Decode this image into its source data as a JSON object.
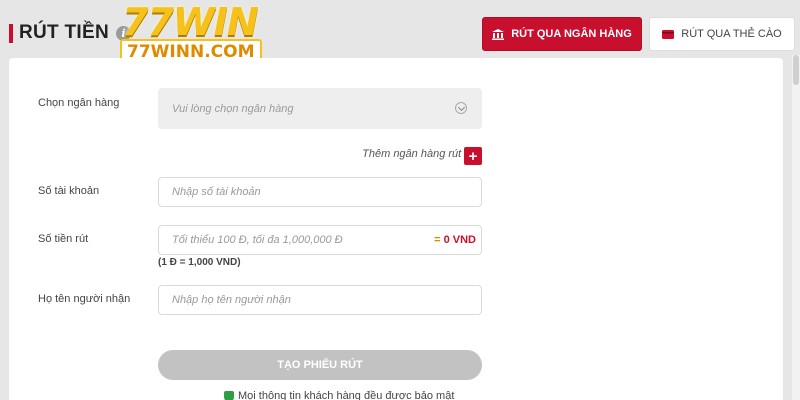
{
  "header": {
    "title": "RÚT TIỀN",
    "info_icon": "i",
    "logo_main": "77WIN",
    "logo_domain": "77WINN.COM"
  },
  "tabs": [
    {
      "label": "RÚT QUA NGÂN HÀNG",
      "icon": "bank-icon",
      "active": true
    },
    {
      "label": "RÚT QUA THẺ CÀO",
      "icon": "card-icon",
      "active": false
    }
  ],
  "form": {
    "bank": {
      "label": "Chọn ngân hàng",
      "placeholder": "Vui lòng chọn ngân hàng"
    },
    "add_bank_label": "Thêm ngân hàng rút tiền",
    "add_bank_button": "+",
    "account": {
      "label": "Số tài khoản",
      "placeholder": "Nhập số tài khoản"
    },
    "amount": {
      "label": "Số tiền rút",
      "placeholder": "Tối thiểu 100 Đ, tối đa 1,000,000 Đ",
      "converted_prefix": "= ",
      "converted": "0 VND",
      "rate": "(1 Đ = 1,000 VND)"
    },
    "recipient": {
      "label": "Họ tên người nhận",
      "placeholder": "Nhập họ tên người nhận"
    },
    "submit_label": "TẠO PHIẾU RÚT",
    "secure_note": "Mọi thông tin khách hàng đều được bảo mật"
  },
  "colors": {
    "accent": "#c8102e",
    "disabled": "#c2c2c2",
    "secure": "#2e9e44"
  }
}
